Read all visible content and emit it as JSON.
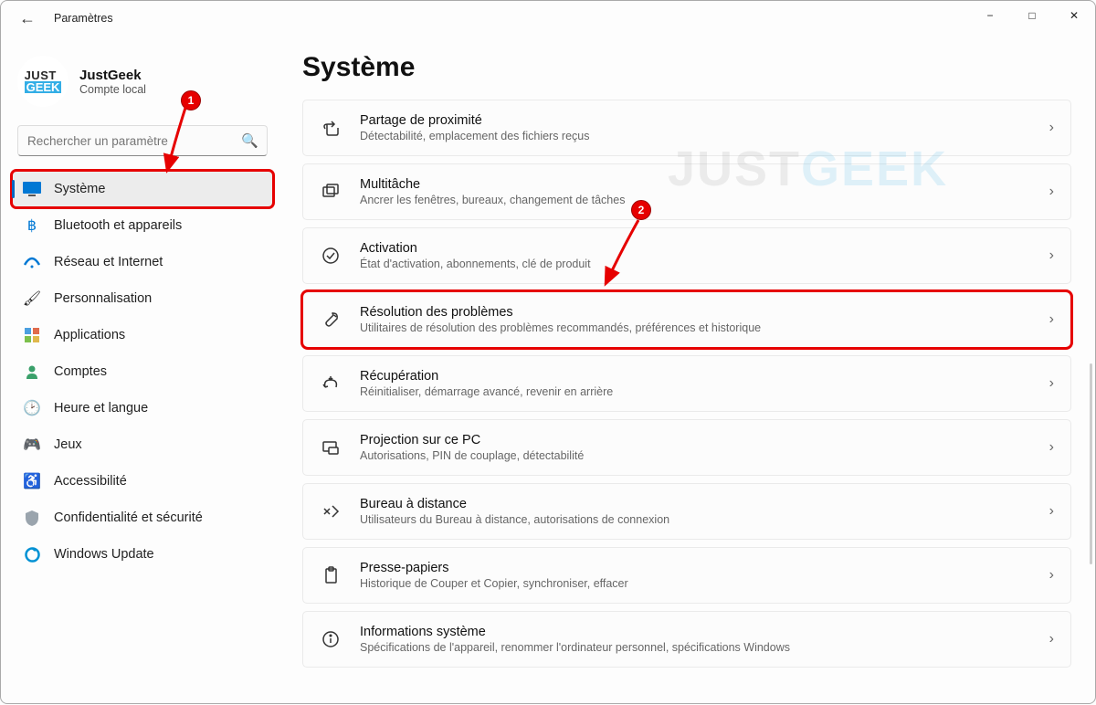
{
  "window": {
    "title": "Paramètres"
  },
  "account": {
    "name": "JustGeek",
    "sub": "Compte local",
    "logo_top": "JUST",
    "logo_bot": "GEEK"
  },
  "search": {
    "placeholder": "Rechercher un paramètre"
  },
  "sidebar": {
    "items": [
      {
        "label": "Système",
        "active": true
      },
      {
        "label": "Bluetooth et appareils"
      },
      {
        "label": "Réseau et Internet"
      },
      {
        "label": "Personnalisation"
      },
      {
        "label": "Applications"
      },
      {
        "label": "Comptes"
      },
      {
        "label": "Heure et langue"
      },
      {
        "label": "Jeux"
      },
      {
        "label": "Accessibilité"
      },
      {
        "label": "Confidentialité et sécurité"
      },
      {
        "label": "Windows Update"
      }
    ]
  },
  "main": {
    "heading": "Système",
    "cards": [
      {
        "title": "Partage de proximité",
        "sub": "Détectabilité, emplacement des fichiers reçus"
      },
      {
        "title": "Multitâche",
        "sub": "Ancrer les fenêtres, bureaux, changement de tâches"
      },
      {
        "title": "Activation",
        "sub": "État d'activation, abonnements, clé de produit"
      },
      {
        "title": "Résolution des problèmes",
        "sub": "Utilitaires de résolution des problèmes recommandés, préférences et historique"
      },
      {
        "title": "Récupération",
        "sub": "Réinitialiser, démarrage avancé, revenir en arrière"
      },
      {
        "title": "Projection sur ce PC",
        "sub": "Autorisations, PIN de couplage, détectabilité"
      },
      {
        "title": "Bureau à distance",
        "sub": "Utilisateurs du Bureau à distance, autorisations de connexion"
      },
      {
        "title": "Presse-papiers",
        "sub": "Historique de Couper et Copier, synchroniser, effacer"
      },
      {
        "title": "Informations système",
        "sub": "Spécifications de l'appareil, renommer l'ordinateur personnel, spécifications Windows"
      }
    ]
  },
  "annotations": {
    "badge1": "1",
    "badge2": "2"
  },
  "watermark": {
    "p1": "JUST",
    "p2": "GEEK"
  }
}
